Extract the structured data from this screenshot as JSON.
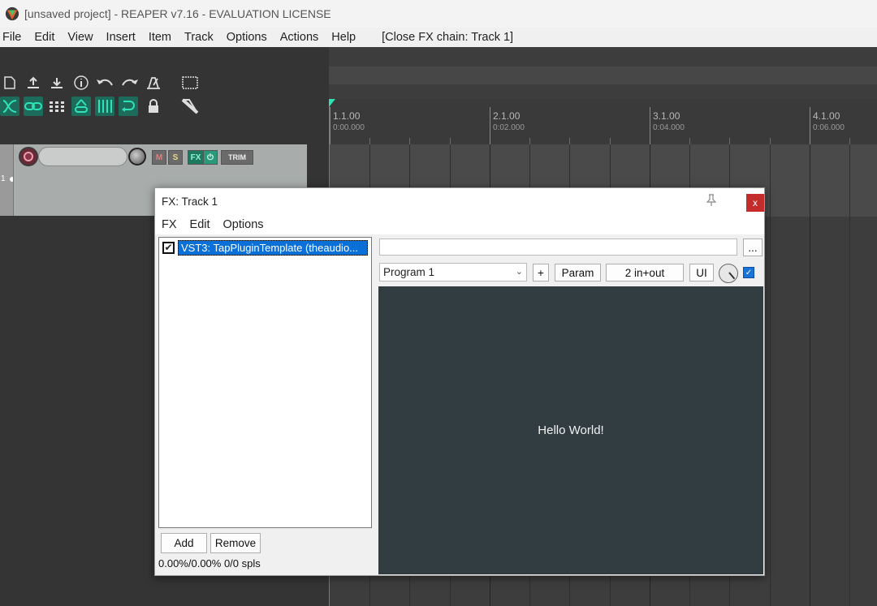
{
  "window": {
    "title": "[unsaved project] - REAPER v7.16 - EVALUATION LICENSE"
  },
  "menubar": {
    "items": [
      "File",
      "Edit",
      "View",
      "Insert",
      "Item",
      "Track",
      "Options",
      "Actions",
      "Help",
      "[Close FX chain: Track 1]"
    ]
  },
  "ruler": {
    "marks": [
      {
        "bar": "1.1.00",
        "time": "0:00.000"
      },
      {
        "bar": "2.1.00",
        "time": "0:02.000"
      },
      {
        "bar": "3.1.00",
        "time": "0:04.000"
      },
      {
        "bar": "4.1.00",
        "time": "0:06.000"
      }
    ]
  },
  "track": {
    "number": "1",
    "mute_label": "M",
    "solo_label": "S",
    "fx_label": "FX",
    "trim_label": "TRIM"
  },
  "fx_window": {
    "title": "FX: Track 1",
    "close_glyph": "x",
    "menu": [
      "FX",
      "Edit",
      "Options"
    ],
    "plugins": [
      {
        "name": "VST3: TapPluginTemplate (theaudio...",
        "enabled": true
      }
    ],
    "add_label": "Add",
    "remove_label": "Remove",
    "stats": "0.00%/0.00% 0/0 spls",
    "preset_name": "",
    "dots_label": "...",
    "program": "Program 1",
    "plus_label": "+",
    "param_label": "Param",
    "io_label": "2 in+out",
    "ui_label": "UI",
    "plugin_text": "Hello World!"
  },
  "colors": {
    "accent": "#2fe3b8",
    "selection": "#0a6fd6",
    "close": "#c42b2b",
    "plugin_bg": "#323d42"
  }
}
